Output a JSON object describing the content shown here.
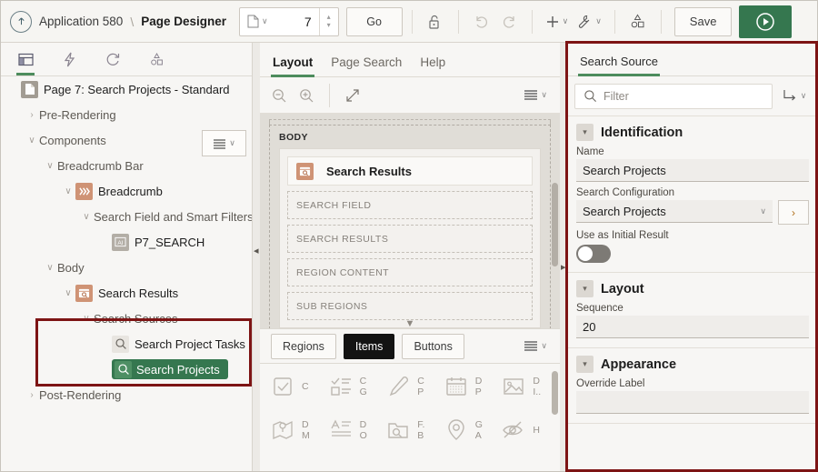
{
  "topbar": {
    "up_icon": "arrow-up-icon",
    "app_label": "Application 580",
    "separator": "\\",
    "page_label": "Page Designer",
    "page_selector": {
      "icon": "page-icon",
      "value": "7",
      "caret": "∨"
    },
    "go_label": "Go",
    "lock_icon": "unlock-icon",
    "undo_icon": "undo-icon",
    "redo_icon": "redo-icon",
    "add_icon": "plus-icon",
    "utilities_icon": "wrench-icon",
    "shapes_icon": "components-icon",
    "save_label": "Save",
    "run_icon": "play-icon",
    "caret": "∨"
  },
  "left_panel": {
    "tabs": [
      {
        "name": "rendering-tab",
        "icon": "layout-grid-icon",
        "active": true
      },
      {
        "name": "dynamic-actions-tab",
        "icon": "lightning-icon",
        "active": false
      },
      {
        "name": "processing-tab",
        "icon": "refresh-icon",
        "active": false
      },
      {
        "name": "page-shared-components-tab",
        "icon": "shapes-icon",
        "active": false
      }
    ],
    "page_menu_icon": "list-menu-icon",
    "page_menu_caret": "∨",
    "tree": [
      {
        "label": "Page 7: Search Projects - Standard",
        "depth": 0,
        "twisty": "",
        "icon": "page-file-icon",
        "bold": true
      },
      {
        "label": "Pre-Rendering",
        "depth": 1,
        "twisty": "›",
        "icon": "",
        "bold": false
      },
      {
        "label": "Components",
        "depth": 1,
        "twisty": "∨",
        "icon": "",
        "bold": false
      },
      {
        "label": "Breadcrumb Bar",
        "depth": 2,
        "twisty": "∨",
        "icon": "",
        "bold": false
      },
      {
        "label": "Breadcrumb",
        "depth": 3,
        "twisty": "∨",
        "icon": "breadcrumb-icon",
        "bold": true
      },
      {
        "label": "Search Field and Smart Filters",
        "depth": 4,
        "twisty": "∨",
        "icon": "",
        "bold": false
      },
      {
        "label": "P7_SEARCH",
        "depth": 5,
        "twisty": "",
        "icon": "text-item-icon",
        "bold": true
      },
      {
        "label": "Body",
        "depth": 2,
        "twisty": "∨",
        "icon": "",
        "bold": false
      },
      {
        "label": "Search Results",
        "depth": 3,
        "twisty": "∨",
        "icon": "search-region-icon",
        "bold": true
      },
      {
        "label": "Search Sources",
        "depth": 4,
        "twisty": "∨",
        "icon": "",
        "bold": false
      },
      {
        "label": "Search Project Tasks",
        "depth": 5,
        "twisty": "",
        "icon": "search-source-icon",
        "bold": true
      },
      {
        "label": "Search Projects",
        "depth": 5,
        "twisty": "",
        "icon": "search-source-icon",
        "bold": true,
        "selected": true
      },
      {
        "label": "Post-Rendering",
        "depth": 1,
        "twisty": "›",
        "icon": "",
        "bold": false
      }
    ]
  },
  "center_panel": {
    "tabs": [
      {
        "label": "Layout",
        "active": true
      },
      {
        "label": "Page Search",
        "active": false
      },
      {
        "label": "Help",
        "active": false
      }
    ],
    "toolbar": {
      "zoom_out_icon": "zoom-out-icon",
      "zoom_in_icon": "zoom-in-icon",
      "expand_icon": "expand-icon",
      "menu_icon": "list-menu-icon",
      "caret": "∨"
    },
    "canvas": {
      "body_label": "BODY",
      "region_name": "Search Results",
      "region_icon": "search-region-icon",
      "slots": [
        "SEARCH FIELD",
        "SEARCH RESULTS",
        "REGION CONTENT",
        "SUB REGIONS"
      ],
      "collapse_arrow": "▼"
    },
    "component_tabs": [
      {
        "label": "Regions",
        "active": false
      },
      {
        "label": "Items",
        "active": true
      },
      {
        "label": "Buttons",
        "active": false
      }
    ],
    "component_menu_icon": "list-menu-icon",
    "gallery": [
      {
        "icon": "checkbox-icon",
        "label": "C"
      },
      {
        "icon": "checkbox-group-icon",
        "label": "C\nG"
      },
      {
        "icon": "color-picker-icon",
        "label": "C\nP"
      },
      {
        "icon": "date-picker-icon",
        "label": "D\nP"
      },
      {
        "icon": "display-image-icon",
        "label": "D\nI.."
      },
      {
        "icon": "map-marker-icon",
        "label": "D\nM"
      },
      {
        "icon": "display-only-icon",
        "label": "D\nO"
      },
      {
        "icon": "file-browse-icon",
        "label": "F.\nB"
      },
      {
        "icon": "geolocation-icon",
        "label": "G\nA"
      },
      {
        "icon": "hidden-icon",
        "label": "H"
      }
    ]
  },
  "right_panel": {
    "tab_label": "Search Source",
    "filter": {
      "icon": "search-icon",
      "placeholder": "Filter",
      "value": ""
    },
    "goto_icon": "go-to-icon",
    "caret": "∨",
    "sections": [
      {
        "title": "Identification",
        "fields": [
          {
            "type": "text",
            "label": "Name",
            "value": "Search Projects"
          },
          {
            "type": "select",
            "label": "Search Configuration",
            "value": "Search Projects",
            "caret": "∨",
            "button_icon": "chevron-right-icon"
          },
          {
            "type": "toggle",
            "label": "Use as Initial Result",
            "value": "off"
          }
        ]
      },
      {
        "title": "Layout",
        "fields": [
          {
            "type": "text",
            "label": "Sequence",
            "value": "20"
          }
        ]
      },
      {
        "title": "Appearance",
        "fields": [
          {
            "type": "text",
            "label": "Override Label",
            "value": ""
          }
        ]
      }
    ]
  },
  "highlights": {
    "color": "#7d1414",
    "regions": [
      "search-sources-tree-group",
      "search-source-property-editor"
    ]
  },
  "colors": {
    "accent_green": "#35774f",
    "tab_underline": "#4d8c5d",
    "highlight_red": "#7d1414",
    "panel_bg": "#f7f6f4",
    "canvas_bg": "#e0ddd7"
  }
}
